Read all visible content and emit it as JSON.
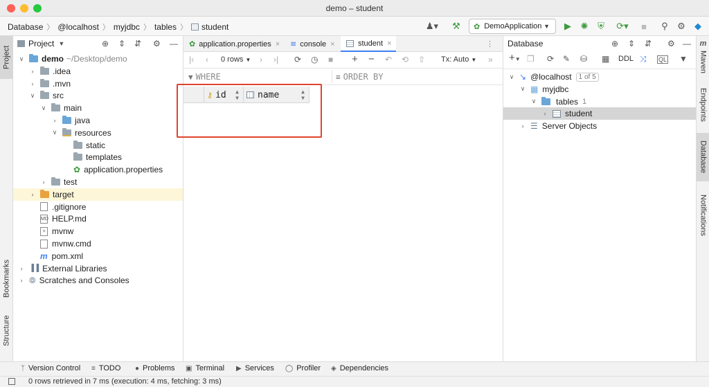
{
  "window": {
    "title": "demo – student"
  },
  "breadcrumbs": [
    "Database",
    "@localhost",
    "myjdbc",
    "tables",
    "student"
  ],
  "run_config": {
    "label": "DemoApplication"
  },
  "left_stripe": {
    "project": "Project",
    "bookmarks": "Bookmarks",
    "structure": "Structure"
  },
  "project": {
    "title": "Project",
    "tree": [
      {
        "label": "demo",
        "suffix": "~/Desktop/demo",
        "icon": "module-folder-icon",
        "arrow": "open"
      },
      {
        "label": ".idea",
        "icon": "folder-icon",
        "arrow": "closed"
      },
      {
        "label": ".mvn",
        "icon": "folder-icon",
        "arrow": "closed"
      },
      {
        "label": "src",
        "icon": "folder-icon",
        "arrow": "open"
      },
      {
        "label": "main",
        "icon": "folder-icon",
        "arrow": "open"
      },
      {
        "label": "java",
        "icon": "source-folder-icon",
        "arrow": "closed"
      },
      {
        "label": "resources",
        "icon": "resources-folder-icon",
        "arrow": "open"
      },
      {
        "label": "static",
        "icon": "folder-icon",
        "arrow": "none"
      },
      {
        "label": "templates",
        "icon": "folder-icon",
        "arrow": "none"
      },
      {
        "label": "application.properties",
        "icon": "spring-properties-icon",
        "arrow": "none"
      },
      {
        "label": "test",
        "icon": "folder-icon",
        "arrow": "closed"
      },
      {
        "label": "target",
        "icon": "excluded-folder-icon",
        "arrow": "closed"
      },
      {
        "label": ".gitignore",
        "icon": "gitignore-file-icon",
        "arrow": "none"
      },
      {
        "label": "HELP.md",
        "icon": "markdown-file-icon",
        "arrow": "none"
      },
      {
        "label": "mvnw",
        "icon": "shell-file-icon",
        "arrow": "none"
      },
      {
        "label": "mvnw.cmd",
        "icon": "text-file-icon",
        "arrow": "none"
      },
      {
        "label": "pom.xml",
        "icon": "maven-file-icon",
        "arrow": "none"
      },
      {
        "label": "External Libraries",
        "icon": "libraries-icon",
        "arrow": "closed"
      },
      {
        "label": "Scratches and Consoles",
        "icon": "scratches-icon",
        "arrow": "closed"
      }
    ]
  },
  "editor": {
    "tabs": [
      {
        "label": "application.properties",
        "icon": "spring-properties-icon",
        "active": false
      },
      {
        "label": "console",
        "icon": "console-icon",
        "active": false
      },
      {
        "label": "student",
        "icon": "table-icon",
        "active": true
      }
    ],
    "rows_label": "0 rows",
    "tx_label": "Tx: Auto",
    "where_label": "WHERE",
    "order_by_label": "ORDER BY",
    "columns": [
      {
        "name": "id",
        "icon": "primary-key-column-icon"
      },
      {
        "name": "name",
        "icon": "column-icon"
      }
    ]
  },
  "database": {
    "title": "Database",
    "ddl_label": "DDL",
    "tree": [
      {
        "label": "@localhost",
        "badge": "1 of 5",
        "icon": "datasource-icon",
        "arrow": "open"
      },
      {
        "label": "myjdbc",
        "icon": "schema-icon",
        "arrow": "open"
      },
      {
        "label": "tables",
        "count": "1",
        "icon": "folder-icon",
        "arrow": "open"
      },
      {
        "label": "student",
        "icon": "table-icon",
        "arrow": "closed",
        "selected": true
      },
      {
        "label": "Server Objects",
        "icon": "server-objects-icon",
        "arrow": "closed"
      }
    ]
  },
  "right_stripe": {
    "maven": "Maven",
    "endpoints": "Endpoints",
    "database": "Database",
    "notifications": "Notifications"
  },
  "tool_windows": [
    "Version Control",
    "TODO",
    "Problems",
    "Terminal",
    "Services",
    "Profiler",
    "Dependencies"
  ],
  "status": {
    "text": "0 rows retrieved in 7 ms (execution: 4 ms, fetching: 3 ms)"
  },
  "colors": {
    "accent": "#3d7ef0",
    "highlight_box": "#e0422c",
    "run_green": "#3c9a3c"
  }
}
